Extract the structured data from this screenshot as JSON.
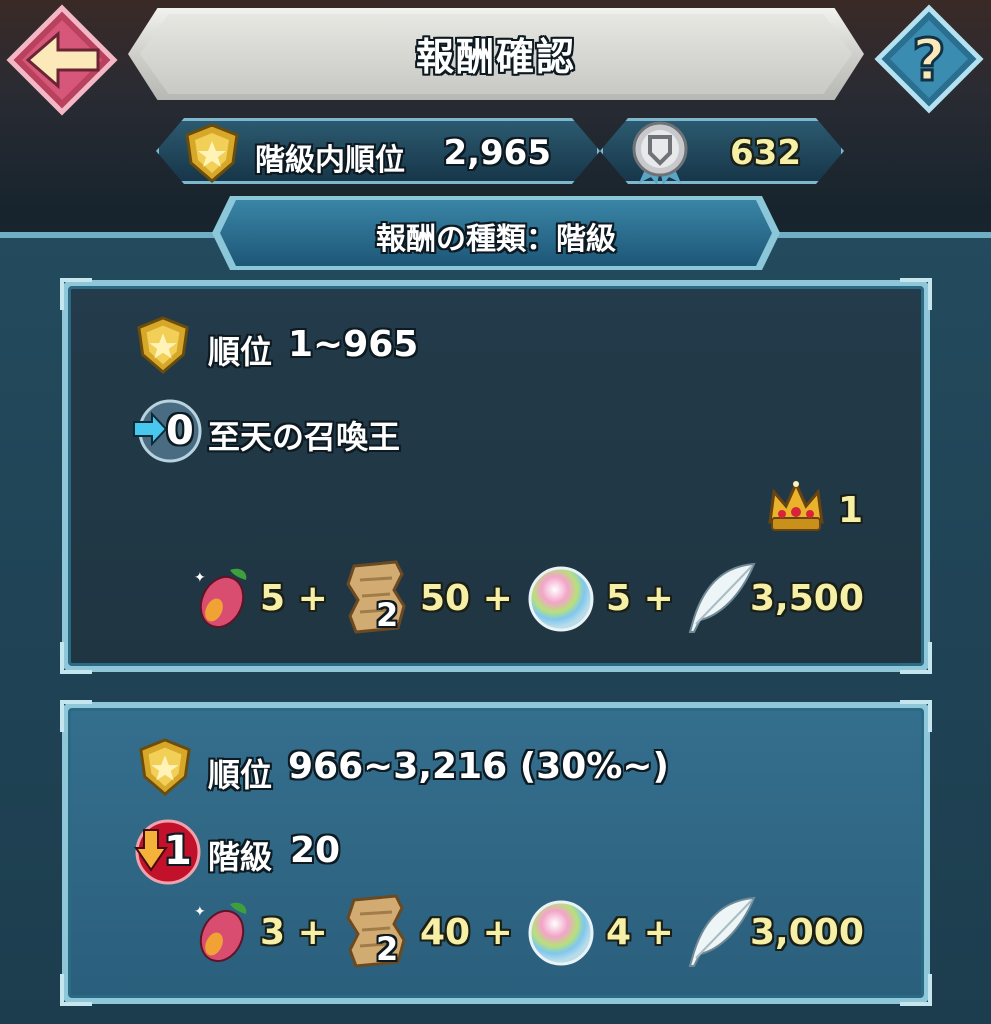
{
  "header": {
    "title": "報酬確認"
  },
  "stats": {
    "rank_label": "階級内順位",
    "rank_value": "2,965",
    "score_value": "632"
  },
  "reward_type_label": "報酬の種類：階級",
  "tiers": [
    {
      "rank_label": "順位",
      "rank_range": "1~965",
      "change_badge": "0",
      "change_text": "至天の召喚王",
      "crown_qty": "1",
      "rewards": [
        {
          "icon": "harmonic-fruit-icon",
          "qty": "5 +"
        },
        {
          "icon": "scroll-icon",
          "badge": "2",
          "qty": "50 +"
        },
        {
          "icon": "orb-icon",
          "qty": "5 +"
        },
        {
          "icon": "feather-icon",
          "qty": "3,500"
        }
      ]
    },
    {
      "rank_label": "順位",
      "rank_range": "966~3,216 (30%~)",
      "change_badge": "1",
      "change_label": "階級",
      "change_value": "20",
      "rewards": [
        {
          "icon": "harmonic-fruit-icon",
          "qty": "3 +"
        },
        {
          "icon": "scroll-icon",
          "badge": "2",
          "qty": "40 +"
        },
        {
          "icon": "orb-icon",
          "qty": "4 +"
        },
        {
          "icon": "feather-icon",
          "qty": "3,000"
        }
      ]
    }
  ],
  "colors": {
    "gold_text": "#f6efa6",
    "panel_border": "#8fc7d8",
    "accent_red": "#c2112a"
  }
}
